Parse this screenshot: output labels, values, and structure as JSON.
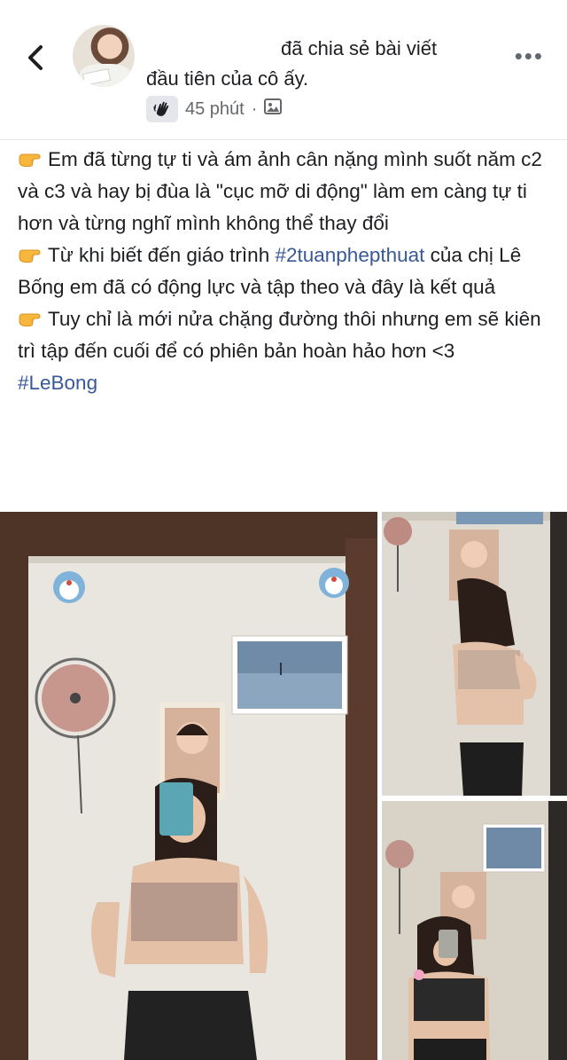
{
  "header": {
    "back_label": "<",
    "title_line1": "đã chia sẻ bài viết",
    "title_line2": "đầu tiên của cô ấy.",
    "time": "45 phút",
    "separator": "·",
    "more_label": "•••",
    "audience_icon": "photo-icon",
    "badge_icon": "waving-hand-icon"
  },
  "post": {
    "paragraphs": [
      {
        "emoji": "👉",
        "text": "Em đã từng tự ti và ám ảnh cân nặng mình suốt năm c2 và c3 và hay bị đùa là \"cục mỡ di động\" làm em càng tự ti hơn và từng nghĩ mình không thể thay đổi"
      },
      {
        "emoji": "👉",
        "text_before": "Từ khi biết đến giáo trình ",
        "hashtag": "#2tuanphepthuat",
        "text_after": " của chị Lê Bống em đã có động lực và tập theo và đây là kết quả"
      },
      {
        "emoji": "👉",
        "text": "Tuy chỉ là mới nửa chặng đường thôi nhưng em sẽ kiên trì tập đến cuối để có phiên bản hoàn hảo hơn  <3"
      }
    ],
    "hashtag": "#LeBong"
  },
  "colors": {
    "link": "#385898",
    "muted": "#65676b",
    "divider": "#e4e6eb"
  }
}
